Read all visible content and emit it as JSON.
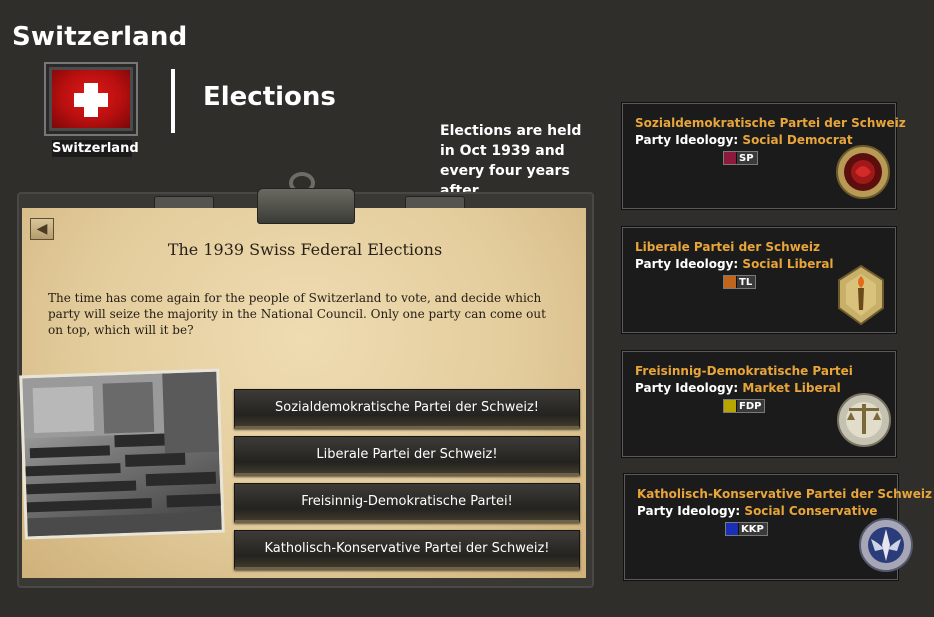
{
  "country": {
    "title": "Switzerland",
    "flag_label": "Switzerland"
  },
  "header": {
    "subtitle": "Elections"
  },
  "note": {
    "text": "Elections are held in Oct 1939 and every four years after."
  },
  "event": {
    "title": "The 1939 Swiss Federal Elections",
    "description": "The time has come again for the people of Switzerland to vote, and decide which party will seize the majority in the National Council. Only one party can come out on top, which will it be?",
    "back_icon": "arrow-left-icon",
    "options": [
      "Sozialdemokratische Partei der Schweiz!",
      "Liberale Partei der Schweiz!",
      "Freisinnig-Demokratische Partei!",
      "Katholisch-Konservative Partei der Schweiz!"
    ]
  },
  "parties": [
    {
      "name": "Sozialdemokratische Partei der Schweiz",
      "ideology_label": "Party Ideology:",
      "ideology": "Social Democrat",
      "tag": "SP",
      "color": "#8b1a3c",
      "medal": "rose-medal-icon"
    },
    {
      "name": "Liberale Partei der Schweiz",
      "ideology_label": "Party Ideology:",
      "ideology": "Social Liberal",
      "tag": "TL",
      "color": "#c0651c",
      "medal": "torch-medal-icon"
    },
    {
      "name": "Freisinnig-Demokratische Partei",
      "ideology_label": "Party Ideology:",
      "ideology": "Market Liberal",
      "tag": "FDP",
      "color": "#b8a500",
      "medal": "scales-medal-icon"
    },
    {
      "name": "Katholisch-Konservative Partei der Schweiz",
      "ideology_label": "Party Ideology:",
      "ideology": "Social Conservative",
      "tag": "KKP",
      "color": "#1a2fb8",
      "medal": "angel-medal-icon"
    }
  ],
  "colors": {
    "accent": "#e8a53a",
    "background": "#2f2e2b"
  }
}
